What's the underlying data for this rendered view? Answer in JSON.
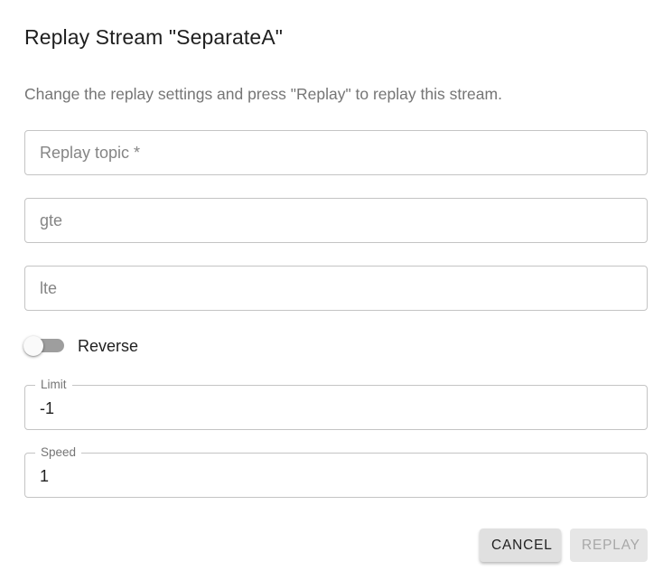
{
  "dialog": {
    "title": "Replay Stream \"SeparateA\"",
    "description": "Change the replay settings and press \"Replay\" to replay this stream."
  },
  "form": {
    "replay_topic": {
      "placeholder": "Replay topic *",
      "value": ""
    },
    "gte": {
      "placeholder": "gte",
      "value": ""
    },
    "lte": {
      "placeholder": "lte",
      "value": ""
    },
    "reverse": {
      "label": "Reverse",
      "checked": false
    },
    "limit": {
      "label": "Limit",
      "value": "-1"
    },
    "speed": {
      "label": "Speed",
      "value": "1"
    }
  },
  "actions": {
    "cancel_label": "Cancel",
    "replay_label": "Replay",
    "replay_disabled": true
  },
  "colors": {
    "border": "#c4c4c4",
    "toggle_track": "#9e9e9e",
    "disabled_text": "#a8a8a8"
  }
}
